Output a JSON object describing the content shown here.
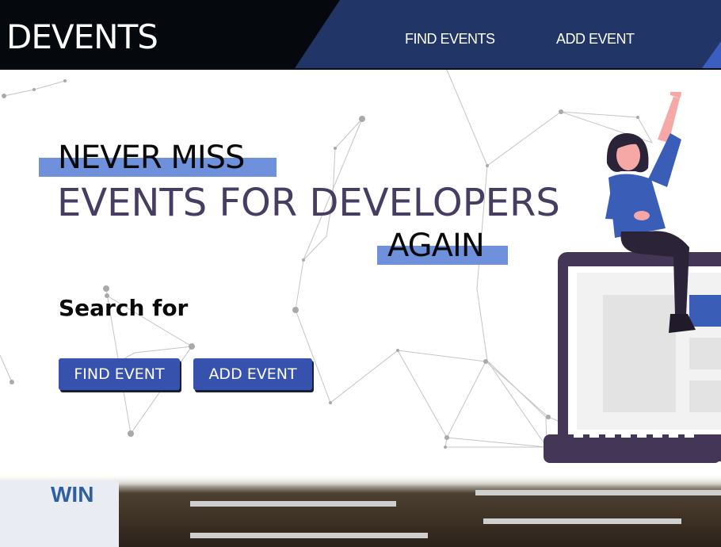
{
  "header": {
    "logo": "DEVENTS",
    "nav": [
      {
        "label": "FIND EVENTS"
      },
      {
        "label": "ADD EVENT"
      }
    ]
  },
  "hero": {
    "headline_line1": "NEVER MISS",
    "headline_line2": "EVENTS FOR DEVELOPERS",
    "headline_line3": "AGAIN",
    "search_label": "Search for",
    "buttons": {
      "find": "FIND EVENT",
      "add": "ADD EVENT"
    }
  },
  "photo": {
    "sign_text": "WIN"
  },
  "colors": {
    "header_dark": "#05080d",
    "header_blue": "#213566",
    "highlight": "#6f91dc",
    "headline_purple": "#473c61",
    "button_blue": "#3752ad",
    "laptop_purple": "#433656"
  }
}
